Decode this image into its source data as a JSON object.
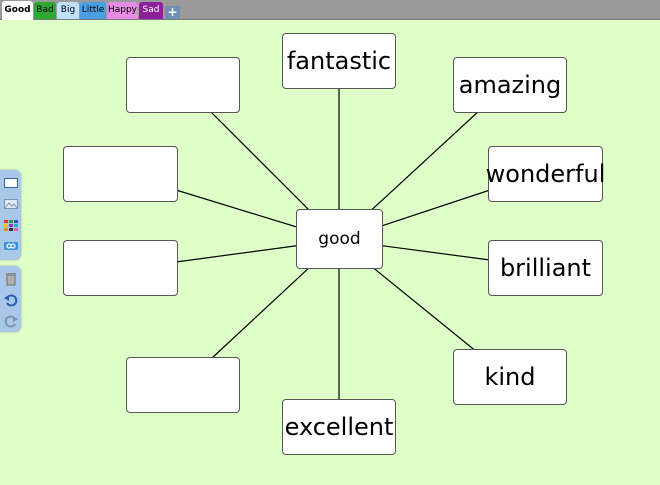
{
  "tabs": [
    {
      "label": "Good",
      "bg": "#ffffff",
      "color": "#000000"
    },
    {
      "label": "Bad",
      "bg": "#2fa82f",
      "color": "#000000"
    },
    {
      "label": "Big",
      "bg": "#bfe0ff",
      "color": "#000000"
    },
    {
      "label": "Little",
      "bg": "#4a9fe0",
      "color": "#000000"
    },
    {
      "label": "Happy",
      "bg": "#e58de5",
      "color": "#000000"
    },
    {
      "label": "Sad",
      "bg": "#8e1f9a",
      "color": "#ffffff"
    }
  ],
  "add_tab_label": "+",
  "mindmap": {
    "center": "good",
    "nodes": [
      "fantastic",
      "amazing",
      "wonderful",
      "brilliant",
      "kind",
      "excellent",
      "",
      "",
      "",
      ""
    ]
  },
  "toolbar": {
    "tools": [
      "text-box-icon",
      "image-icon",
      "colour-palette-icon",
      "link-icon",
      "trash-icon",
      "undo-icon",
      "redo-icon"
    ]
  },
  "colors": {
    "background": "#dfffc9",
    "toolbar": "#a9c7e8",
    "line": "#000000"
  }
}
